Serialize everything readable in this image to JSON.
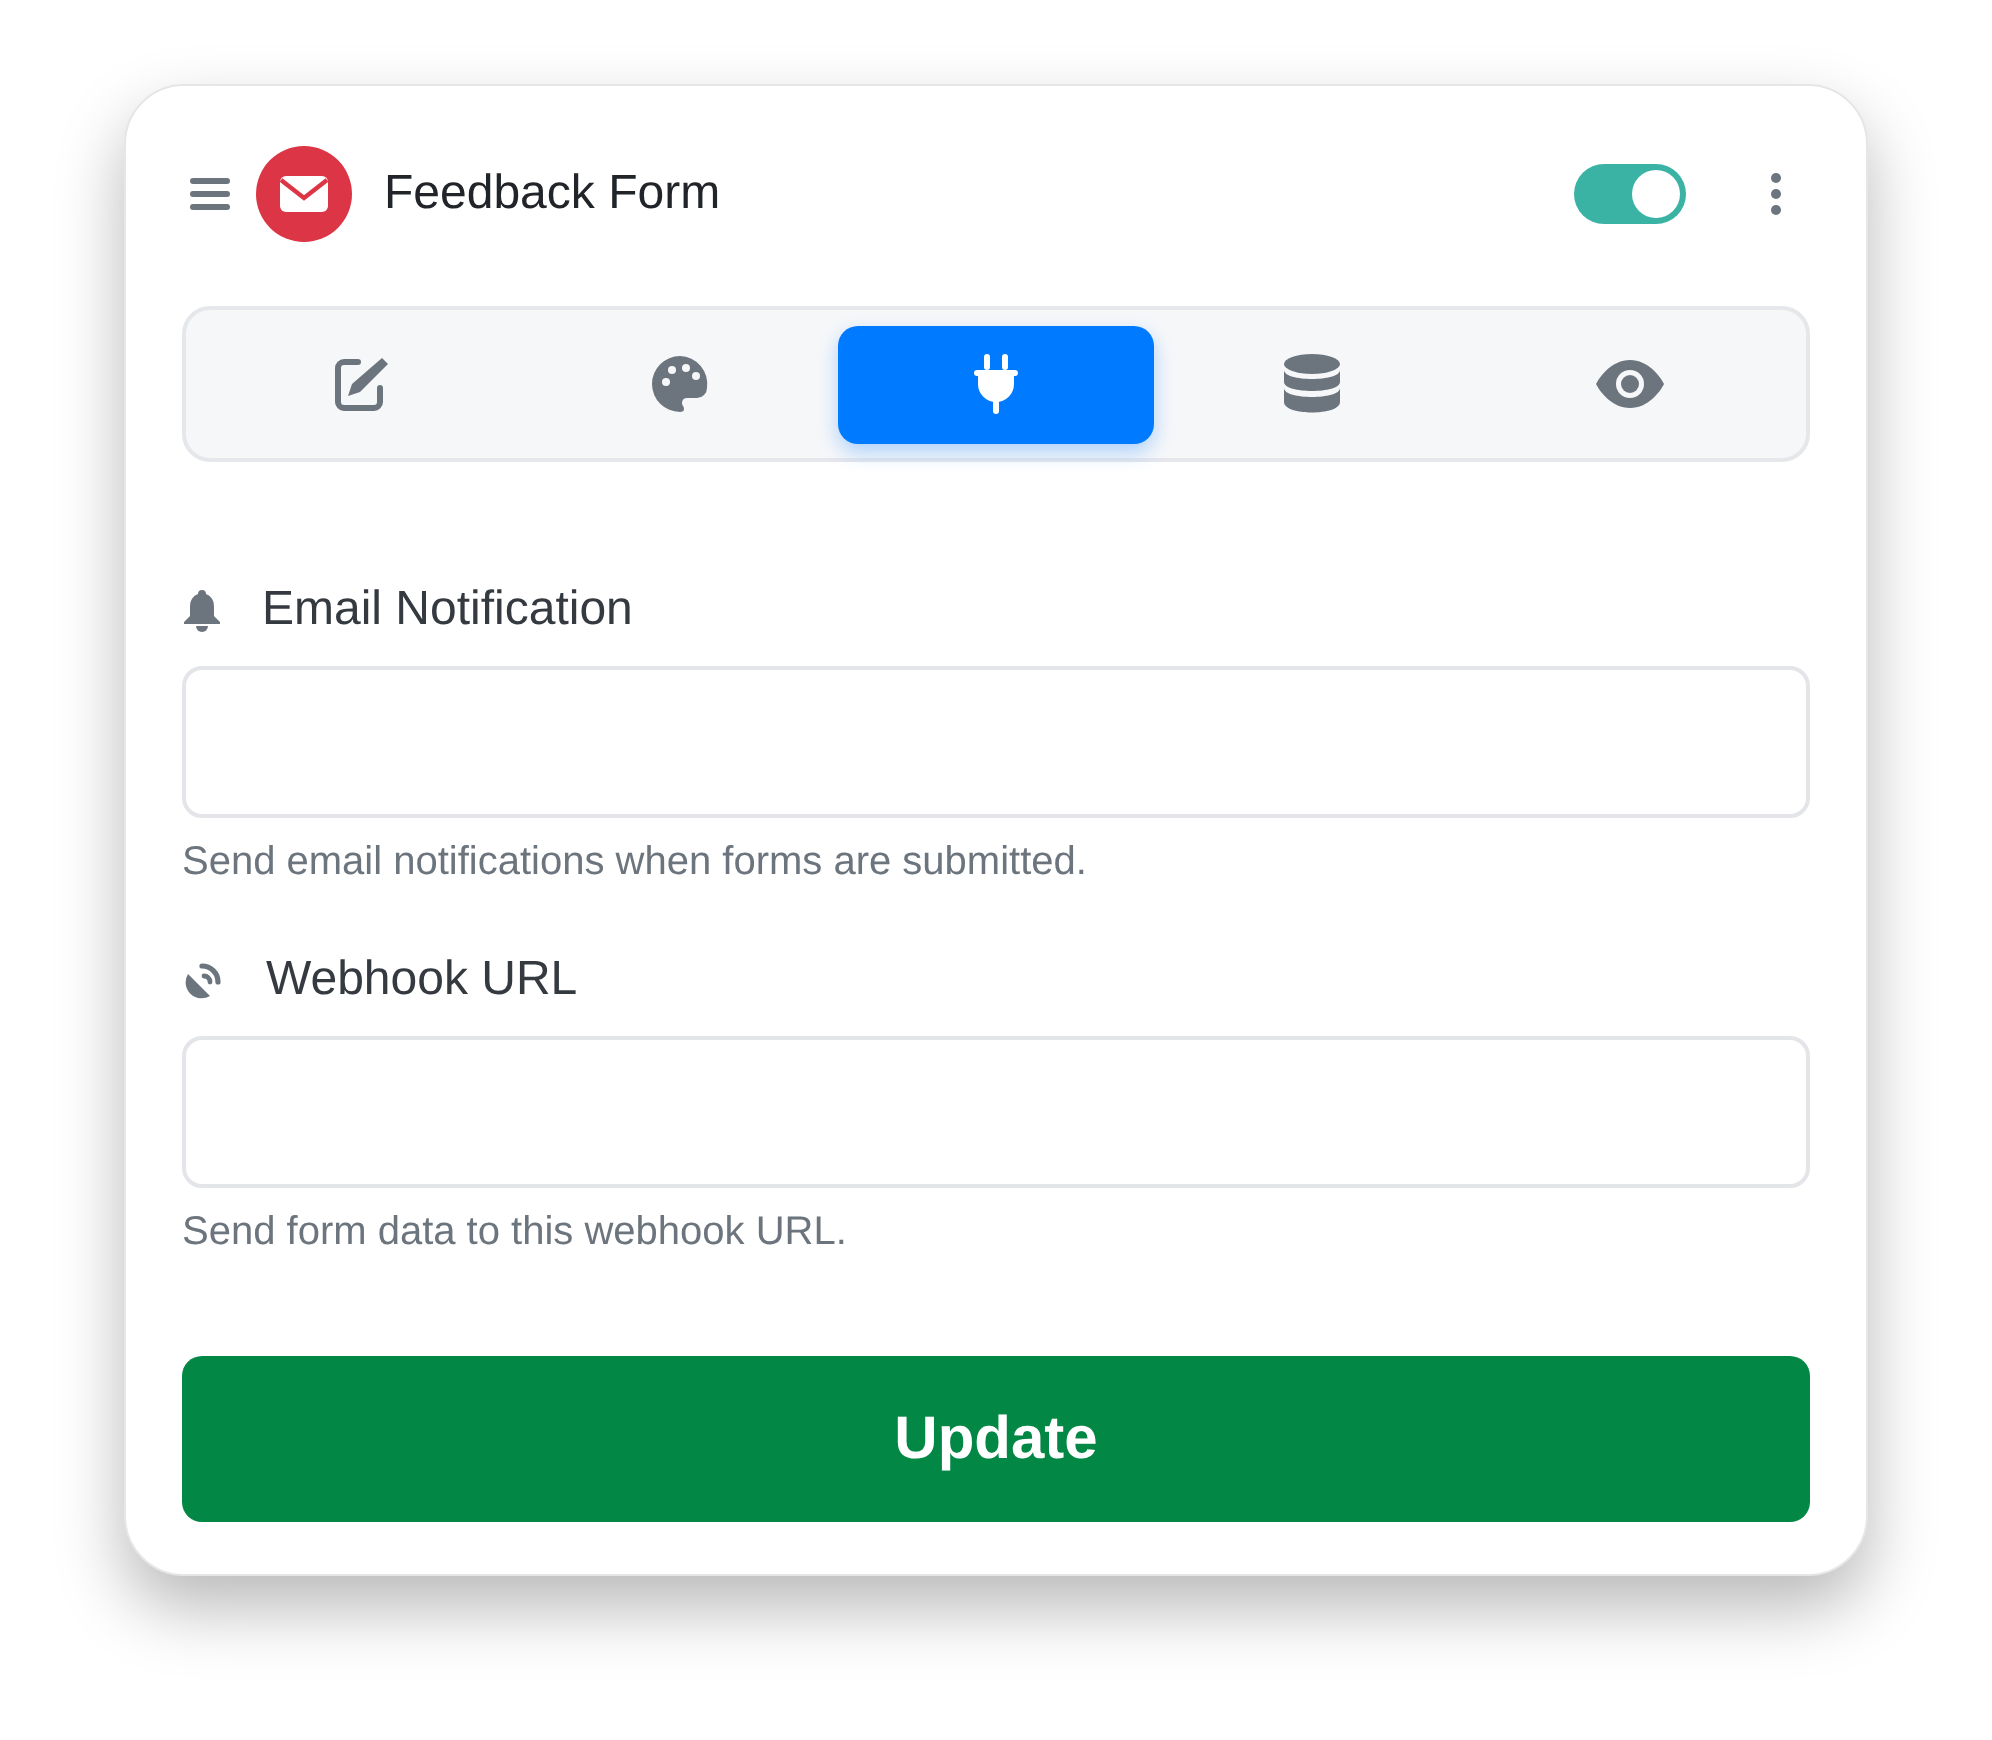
{
  "header": {
    "title": "Feedback Form",
    "toggle_on": true
  },
  "tabs": [
    {
      "kind": "edit",
      "selected": false
    },
    {
      "kind": "palette",
      "selected": false
    },
    {
      "kind": "plug",
      "selected": true
    },
    {
      "kind": "database",
      "selected": false
    },
    {
      "kind": "eye",
      "selected": false
    }
  ],
  "fields": [
    {
      "kind": "bell",
      "label": "Email Notification",
      "help": "Send email notifications when forms are submitted."
    },
    {
      "kind": "dish",
      "label": "Webhook URL",
      "help": "Send form data to this webhook URL."
    }
  ],
  "submit_button": "Update"
}
